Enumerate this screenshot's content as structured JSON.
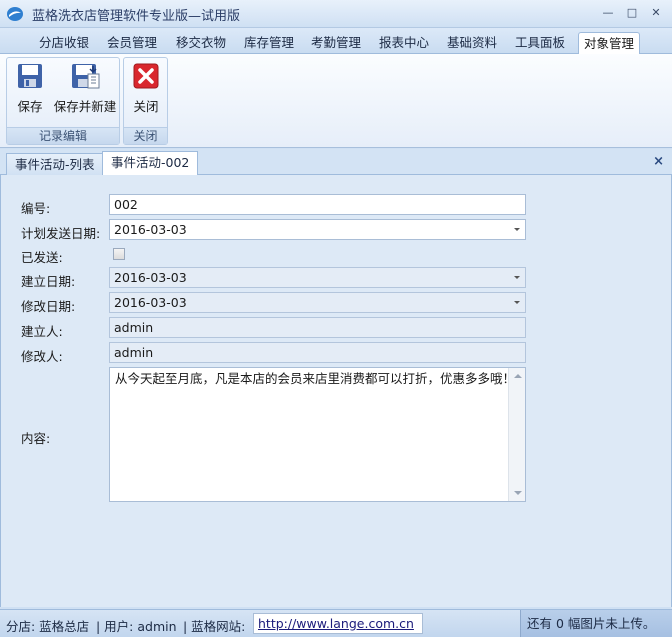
{
  "window": {
    "title": "蓝格洗衣店管理软件专业版—试用版",
    "minimize_glyph": "—",
    "maximize_glyph": "□",
    "close_glyph": "✕"
  },
  "menu": {
    "tabs": [
      "分店收银",
      "会员管理",
      "移交衣物",
      "库存管理",
      "考勤管理",
      "报表中心",
      "基础资料",
      "工具面板",
      "对象管理"
    ],
    "active_index": 8
  },
  "ribbon": {
    "groups": [
      {
        "label": "记录编辑",
        "buttons": [
          {
            "label": "保存",
            "icon": "save-icon"
          },
          {
            "label": "保存并新建",
            "icon": "save-new-icon"
          }
        ]
      },
      {
        "label": "关闭",
        "buttons": [
          {
            "label": "关闭",
            "icon": "close-red-icon"
          }
        ]
      }
    ]
  },
  "doc_tabs": {
    "items": [
      "事件活动-列表",
      "事件活动-002"
    ],
    "active_index": 1,
    "close_glyph": "×"
  },
  "form": {
    "code_label": "编号:",
    "code_value": "002",
    "plan_date_label": "计划发送日期:",
    "plan_date_value": "2016-03-03",
    "sent_label": "已发送:",
    "sent_checked": false,
    "created_date_label": "建立日期:",
    "created_date_value": "2016-03-03",
    "modified_date_label": "修改日期:",
    "modified_date_value": "2016-03-03",
    "creator_label": "建立人:",
    "creator_value": "admin",
    "modifier_label": "修改人:",
    "modifier_value": "admin",
    "content_label": "内容:",
    "content_value": "从今天起至月底，凡是本店的会员来店里消费都可以打折，优惠多多哦！"
  },
  "status": {
    "store": "分店: 蓝格总店",
    "user": "| 用户: admin",
    "site_label": "| 蓝格网站:",
    "site_url": "http://www.lange.com.cn",
    "upload_notice": "还有 0 幅图片未上传。"
  },
  "colors": {
    "accent": "#3b6fb6",
    "panel_bg": "#dde9f6",
    "close_red": "#d9272e"
  }
}
